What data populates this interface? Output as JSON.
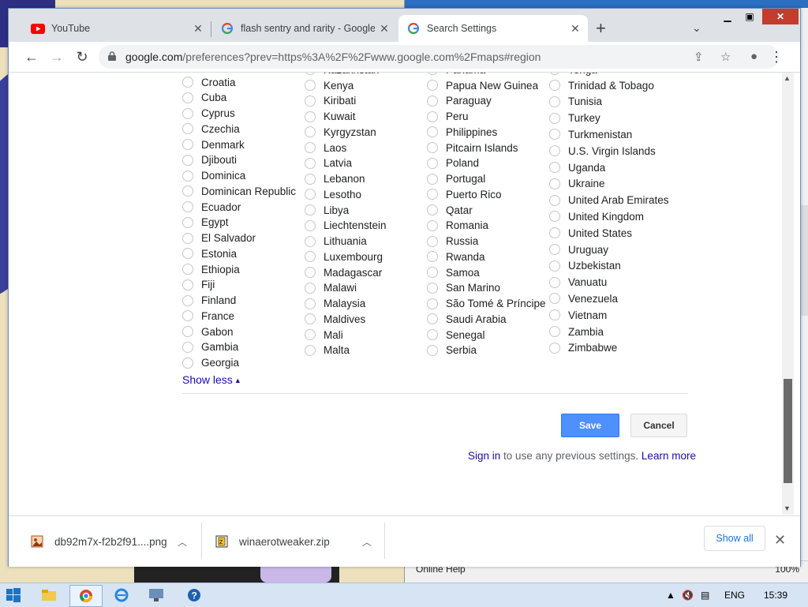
{
  "browser": {
    "tabs": [
      {
        "title": "YouTube",
        "icon": "youtube-icon",
        "active": false
      },
      {
        "title": "flash sentry and rarity - Google S",
        "icon": "google-icon",
        "active": false
      },
      {
        "title": "Search Settings",
        "icon": "google-icon",
        "active": true
      }
    ],
    "new_tab_label": "+",
    "url_host": "google.com",
    "url_path": "/preferences?prev=https%3A%2F%2Fwww.google.com%2Fmaps#region"
  },
  "regions": {
    "col1": [
      "Croatia",
      "Cuba",
      "Cyprus",
      "Czechia",
      "Denmark",
      "Djibouti",
      "Dominica",
      "Dominican Republic",
      "Ecuador",
      "Egypt",
      "El Salvador",
      "Estonia",
      "Ethiopia",
      "Fiji",
      "Finland",
      "France",
      "Gabon",
      "Gambia",
      "Georgia"
    ],
    "col2_top": "Kazakhstan",
    "col2": [
      "Kenya",
      "Kiribati",
      "Kuwait",
      "Kyrgyzstan",
      "Laos",
      "Latvia",
      "Lebanon",
      "Lesotho",
      "Libya",
      "Liechtenstein",
      "Lithuania",
      "Luxembourg",
      "Madagascar",
      "Malawi",
      "Malaysia",
      "Maldives",
      "Mali",
      "Malta"
    ],
    "col3_top": "Panama",
    "col3": [
      "Papua New Guinea",
      "Paraguay",
      "Peru",
      "Philippines",
      "Pitcairn Islands",
      "Poland",
      "Portugal",
      "Puerto Rico",
      "Qatar",
      "Romania",
      "Russia",
      "Rwanda",
      "Samoa",
      "San Marino",
      "São Tomé & Príncipe",
      "Saudi Arabia",
      "Senegal",
      "Serbia"
    ],
    "col4_top": "Tonga",
    "col4": [
      "Trinidad & Tobago",
      "Tunisia",
      "Turkey",
      "Turkmenistan",
      "U.S. Virgin Islands",
      "Uganda",
      "Ukraine",
      "United Arab Emirates",
      "United Kingdom",
      "United States",
      "Uruguay",
      "Uzbekistan",
      "Vanuatu",
      "Venezuela",
      "Vietnam",
      "Zambia",
      "Zimbabwe"
    ]
  },
  "show_less": "Show less",
  "buttons": {
    "save": "Save",
    "cancel": "Cancel"
  },
  "signin": {
    "link": "Sign in",
    "text": "to use any previous settings.",
    "learn_more": "Learn more"
  },
  "downloads": {
    "items": [
      {
        "name": "db92m7x-f2b2f91....png"
      },
      {
        "name": "winaerotweaker.zip"
      }
    ],
    "show_all": "Show all"
  },
  "background_window": {
    "help": "Online Help",
    "zoom": "100%"
  },
  "taskbar": {
    "lang": "ENG",
    "time": "15:39"
  },
  "colors": {
    "accent": "#4d90fe",
    "link": "#1a0dab"
  }
}
